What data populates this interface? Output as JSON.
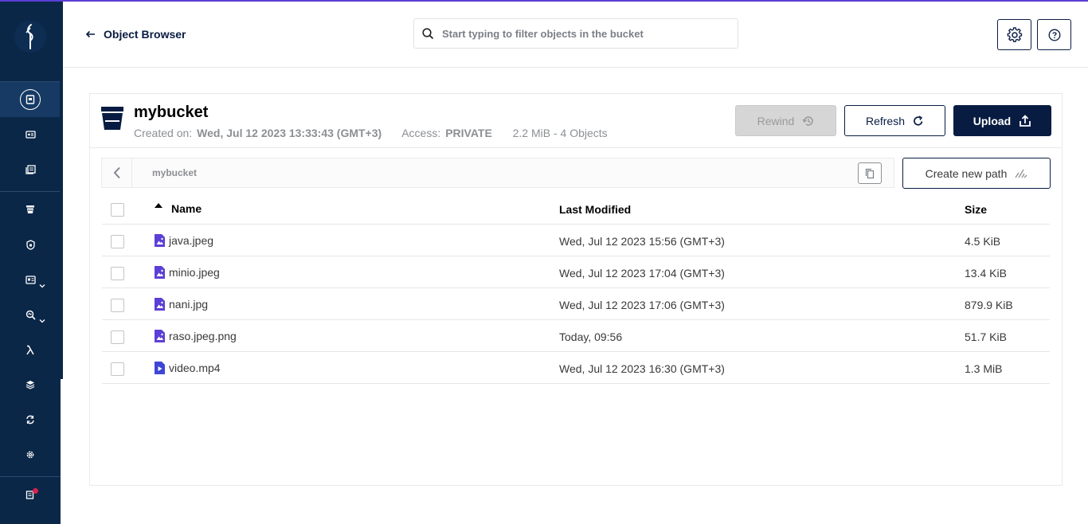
{
  "colors": {
    "sidebar": "#0b2748",
    "accent": "#081c42",
    "top_line": "#5b3fd6",
    "file_icon": "#5b3fd6",
    "notification_dot": "#d9214e"
  },
  "sidebar": {
    "items": [
      {
        "icon": "object-browser-icon",
        "active": true
      },
      {
        "icon": "access-keys-icon"
      },
      {
        "icon": "documentation-icon"
      },
      {
        "icon": "buckets-icon"
      },
      {
        "icon": "policies-icon"
      },
      {
        "icon": "identity-icon",
        "expandable": true
      },
      {
        "icon": "monitoring-icon",
        "expandable": true
      },
      {
        "icon": "events-lambda-icon"
      },
      {
        "icon": "tiering-icon"
      },
      {
        "icon": "site-replication-icon"
      },
      {
        "icon": "settings-icon"
      },
      {
        "icon": "license-icon",
        "badge": true
      }
    ]
  },
  "header": {
    "back_label": "Object Browser",
    "search_placeholder": "Start typing to filter objects in the bucket"
  },
  "bucket": {
    "name": "mybucket",
    "created_label": "Created on:",
    "created_value": "Wed, Jul 12 2023 13:33:43 (GMT+3)",
    "access_label": "Access:",
    "access_value": "PRIVATE",
    "summary": "2.2 MiB - 4 Objects"
  },
  "actions": {
    "rewind": "Rewind",
    "refresh": "Refresh",
    "upload": "Upload",
    "create_path": "Create new path"
  },
  "breadcrumb": {
    "path": "mybucket"
  },
  "table": {
    "columns": {
      "name": "Name",
      "modified": "Last Modified",
      "size": "Size"
    },
    "rows": [
      {
        "name": "java.jpeg",
        "type": "image",
        "modified": "Wed, Jul 12 2023 15:56 (GMT+3)",
        "size": "4.5 KiB"
      },
      {
        "name": "minio.jpeg",
        "type": "image",
        "modified": "Wed, Jul 12 2023 17:04 (GMT+3)",
        "size": "13.4 KiB"
      },
      {
        "name": "nani.jpg",
        "type": "image",
        "modified": "Wed, Jul 12 2023 17:06 (GMT+3)",
        "size": "879.9 KiB"
      },
      {
        "name": "raso.jpeg.png",
        "type": "image",
        "modified": "Today, 09:56",
        "size": "51.7 KiB"
      },
      {
        "name": "video.mp4",
        "type": "video",
        "modified": "Wed, Jul 12 2023 16:30 (GMT+3)",
        "size": "1.3 MiB"
      }
    ]
  }
}
